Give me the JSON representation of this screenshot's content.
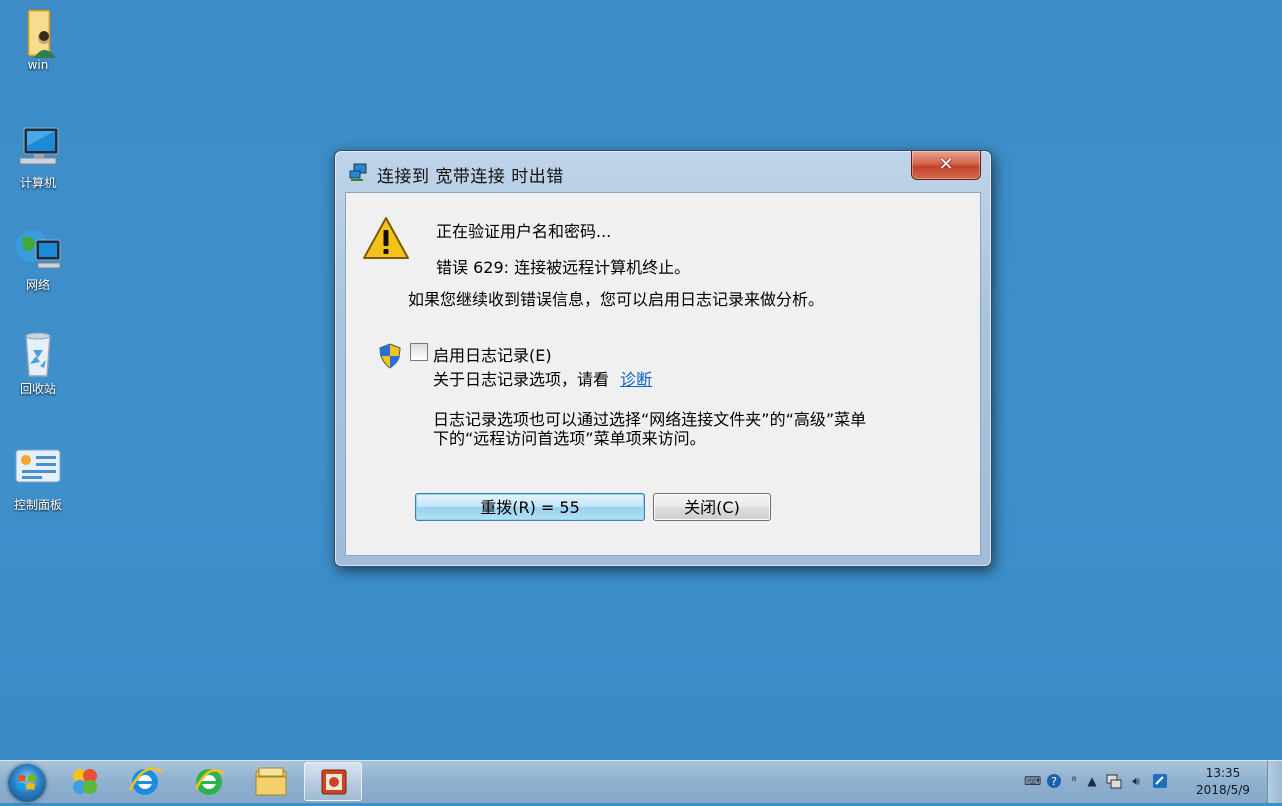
{
  "desktop": {
    "icons": [
      {
        "label": "win",
        "icon": "user-folder-icon"
      },
      {
        "label": "计算机",
        "icon": "computer-icon"
      },
      {
        "label": "网络",
        "icon": "network-icon"
      },
      {
        "label": "回收站",
        "icon": "recycle-bin-icon"
      },
      {
        "label": "控制面板",
        "icon": "control-panel-icon"
      }
    ]
  },
  "dialog": {
    "title": "连接到 宽带连接 时出错",
    "close_label": "✕",
    "status_line": "正在验证用户名和密码...",
    "error_line": "错误 629: 连接被远程计算机终止。",
    "advice_line": "如果您继续收到错误信息，您可以启用日志记录来做分析。",
    "logging_checkbox_label": "启用日志记录(E)",
    "logging_checked": false,
    "logging_info_prefix": "关于日志记录选项，请看",
    "diagnose_link": "诊断",
    "note_line1": "日志记录选项也可以通过选择“网络连接文件夹”的“高级”菜单",
    "note_line2": "下的“远程访问首选项”菜单项来访问。",
    "redial_button": "重拨(R) = 55",
    "close_button": "关闭(C)"
  },
  "taskbar": {
    "apps": [
      {
        "name": "media-app-icon"
      },
      {
        "name": "internet-explorer-icon"
      },
      {
        "name": "browser-icon"
      },
      {
        "name": "file-explorer-icon"
      },
      {
        "name": "presentation-app-icon",
        "active": true
      }
    ],
    "clock_time": "13:35",
    "clock_date": "2018/5/9"
  }
}
